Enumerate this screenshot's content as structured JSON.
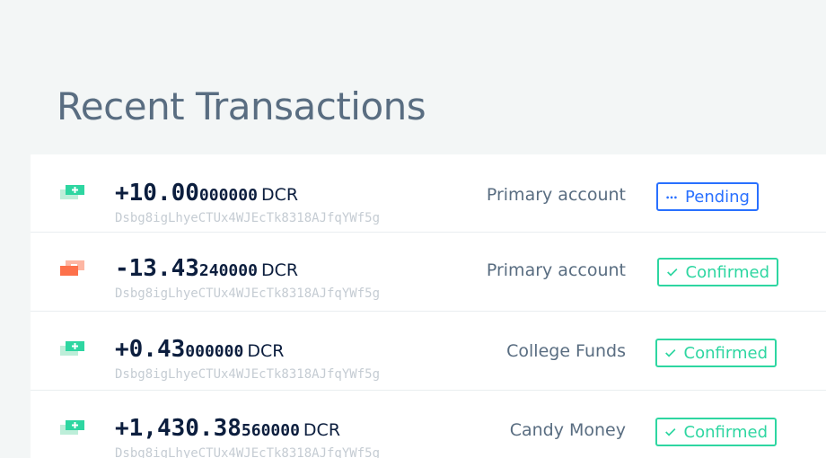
{
  "page": {
    "title": "Recent Transactions"
  },
  "colors": {
    "background": "#f3f6f6",
    "title": "#596d81",
    "amount": "#0c1e3e",
    "address": "#c5ccd3",
    "received_icon": "#2ed6a1",
    "sent_icon": "#fd714b",
    "pending": "#2970ff",
    "confirmed": "#2ed6a1"
  },
  "transactions": [
    {
      "direction": "received",
      "icon": "received-icon",
      "amount_main": "+10.00",
      "amount_tail": "000000",
      "unit": "DCR",
      "address": "Dsbg8igLhyeCTUx4WJEcTk8318AJfqYWf5g",
      "account": "Primary account",
      "status": "Pending",
      "status_icon": "ellipsis-icon"
    },
    {
      "direction": "sent",
      "icon": "sent-icon",
      "amount_main": "-13.43",
      "amount_tail": "240000",
      "unit": "DCR",
      "address": "Dsbg8igLhyeCTUx4WJEcTk8318AJfqYWf5g",
      "account": "Primary account",
      "status": "Confirmed",
      "status_icon": "checkmark-icon"
    },
    {
      "direction": "received",
      "icon": "received-icon",
      "amount_main": "+0.43",
      "amount_tail": "000000",
      "unit": "DCR",
      "address": "Dsbg8igLhyeCTUx4WJEcTk8318AJfqYWf5g",
      "account": "College Funds",
      "status": "Confirmed",
      "status_icon": "checkmark-icon"
    },
    {
      "direction": "received",
      "icon": "received-icon",
      "amount_main": "+1,430.38",
      "amount_tail": "560000",
      "unit": "DCR",
      "address": "Dsbg8igLhyeCTUx4WJEcTk8318AJfqYWf5g",
      "account": "Candy Money",
      "status": "Confirmed",
      "status_icon": "checkmark-icon"
    }
  ]
}
